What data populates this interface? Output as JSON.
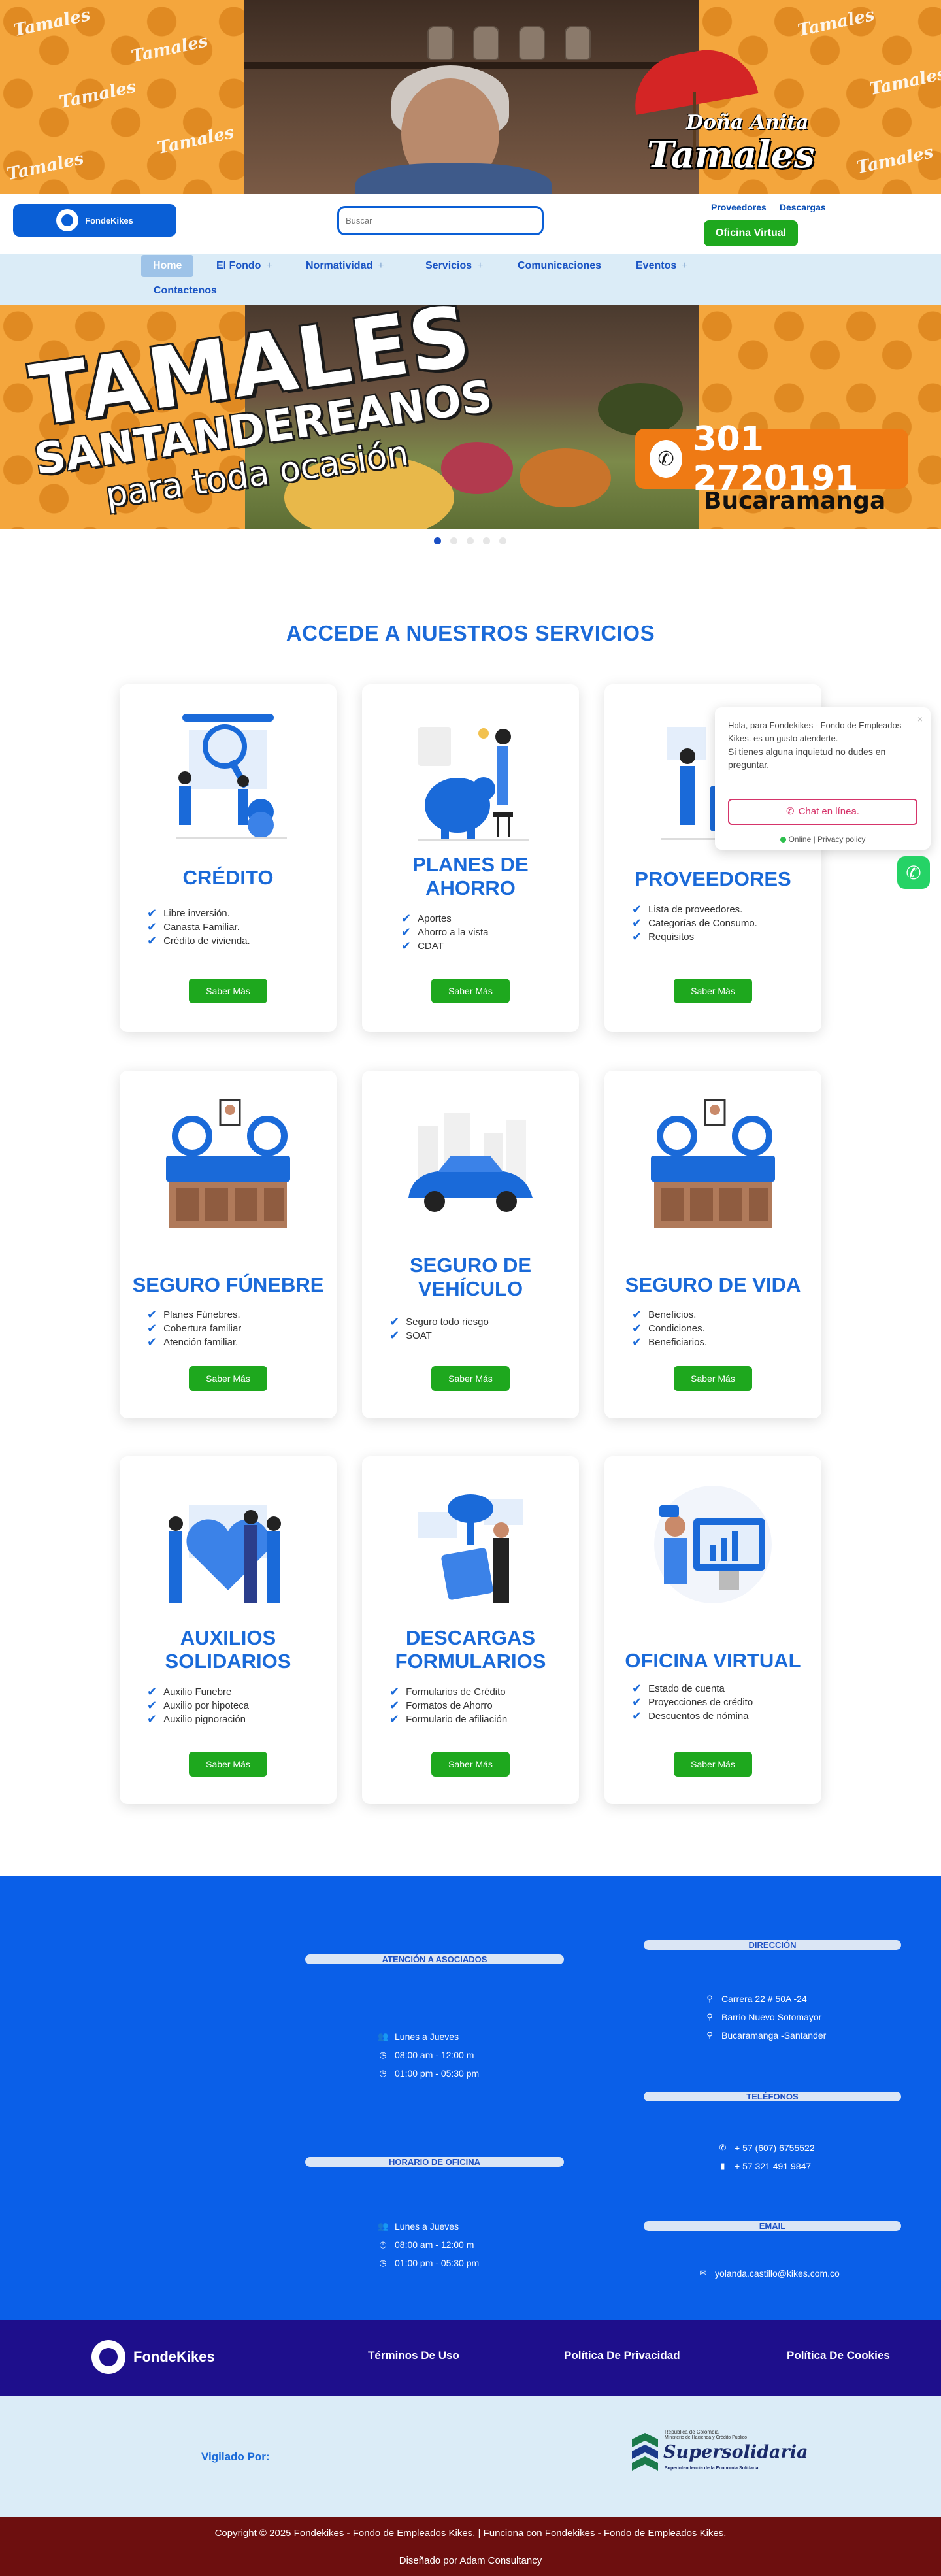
{
  "promo": {
    "brand_line1": "Doña Anita",
    "brand_line2": "Tamales",
    "pattern_word": "Tamales"
  },
  "header": {
    "logo_text": "FondeKikes",
    "search_placeholder": "Buscar",
    "top_links": [
      "Proveedores",
      "Descargas"
    ],
    "oficina_button": "Oficina Virtual"
  },
  "nav": {
    "items": [
      {
        "label": "Home",
        "has_sub": false
      },
      {
        "label": "El Fondo",
        "has_sub": true
      },
      {
        "label": "Normatividad",
        "has_sub": true
      },
      {
        "label": "Servicios",
        "has_sub": true
      },
      {
        "label": "Comunicaciones",
        "has_sub": false
      },
      {
        "label": "Eventos",
        "has_sub": true
      },
      {
        "label": "Contactenos",
        "has_sub": false
      }
    ],
    "sub_icon": "+"
  },
  "hero": {
    "line1": "TAMALES",
    "line2": "SANTANDEREANOS",
    "line3": "para toda ocasión",
    "phone": "301 2720191",
    "city": "Bucaramanga",
    "slides": 5,
    "active_slide": 1
  },
  "services": {
    "title": "ACCEDE A NUESTROS SERVICIOS",
    "button_label": "Saber Más",
    "cards": [
      {
        "title": "CRÉDITO",
        "items": [
          "Libre inversión.",
          "Canasta Familiar.",
          "Crédito de vivienda."
        ]
      },
      {
        "title": "PLANES DE AHORRO",
        "items": [
          "Aportes",
          "Ahorro a la vista",
          "CDAT"
        ]
      },
      {
        "title": "PROVEEDORES",
        "items": [
          "Lista de proveedores.",
          "Categorías de Consumo.",
          "Requisitos"
        ]
      },
      {
        "title": "SEGURO FÚNEBRE",
        "items": [
          "Planes Fúnebres.",
          "Cobertura familiar",
          "Atención familiar."
        ]
      },
      {
        "title": "SEGURO DE VEHÍCULO",
        "items": [
          "Seguro todo riesgo",
          "SOAT"
        ]
      },
      {
        "title": "SEGURO DE VIDA",
        "items": [
          "Beneficios.",
          "Condiciones.",
          "Beneficiarios."
        ]
      },
      {
        "title": "AUXILIOS SOLIDARIOS",
        "items": [
          "Auxilio Funebre",
          "Auxilio por hipoteca",
          "Auxilio pignoración"
        ]
      },
      {
        "title": "DESCARGAS FORMULARIOS",
        "items": [
          "Formularios de Crédito",
          "Formatos de Ahorro",
          "Formulario de afiliación"
        ]
      },
      {
        "title": "OFICINA VIRTUAL",
        "items": [
          "Estado de cuenta",
          "Proyecciones de crédito",
          "Descuentos de nómina"
        ]
      }
    ]
  },
  "chat": {
    "message_1": "Hola, para Fondekikes - Fondo de Empleados Kikes. es un gusto atenderte.",
    "message_2": "Si tienes alguna inquietud no dudes en preguntar.",
    "button": "Chat en línea.",
    "status": "Online | Privacy policy",
    "close": "×"
  },
  "info": {
    "atencion_title": "ATENCIÓN A ASOCIADOS",
    "atencion": [
      "Lunes a Jueves",
      "08:00 am - 12:00 m",
      "01:00 pm - 05:30 pm"
    ],
    "horario_title": "HORARIO DE OFICINA",
    "horario": [
      "Lunes a Jueves",
      "08:00 am - 12:00 m",
      "01:00 pm - 05:30 pm"
    ],
    "direccion_title": "DIRECCIÓN",
    "direccion": [
      "Carrera 22 # 50A -24",
      "Barrio Nuevo Sotomayor",
      "Bucaramanga -Santander"
    ],
    "telefonos_title": "TELÉFONOS",
    "telefonos": [
      "+ 57 (607) 6755522",
      "+ 57 321 491 9847"
    ],
    "email_title": "EMAIL",
    "email": "yolanda.castillo@kikes.com.co"
  },
  "footer": {
    "logo_text": "FondeKikes",
    "links": [
      "Términos De Uso",
      "Política De Privacidad",
      "Política De Cookies"
    ],
    "vigilado_label": "Vigilado Por:",
    "super_top": "República de Colombia",
    "super_sub": "Ministerio de Hacienda y Crédito Público",
    "super_name": "Supersolidaria",
    "super_bottom": "Superintendencia de la Economía Solidaria",
    "copyright": "Copyright © 2025 Fondekikes - Fondo de Empleados Kikes. | Funciona con Fondekikes - Fondo de Empleados Kikes.",
    "designed": "Diseñado por Adam Consultancy"
  },
  "colors": {
    "primary_blue": "#0a5fd6",
    "title_blue": "#1a6ad9",
    "green": "#1ea81e",
    "footer_purple": "#1e0f8c",
    "copyright_bg": "#6d0f0f",
    "orange": "#f4a63d"
  }
}
